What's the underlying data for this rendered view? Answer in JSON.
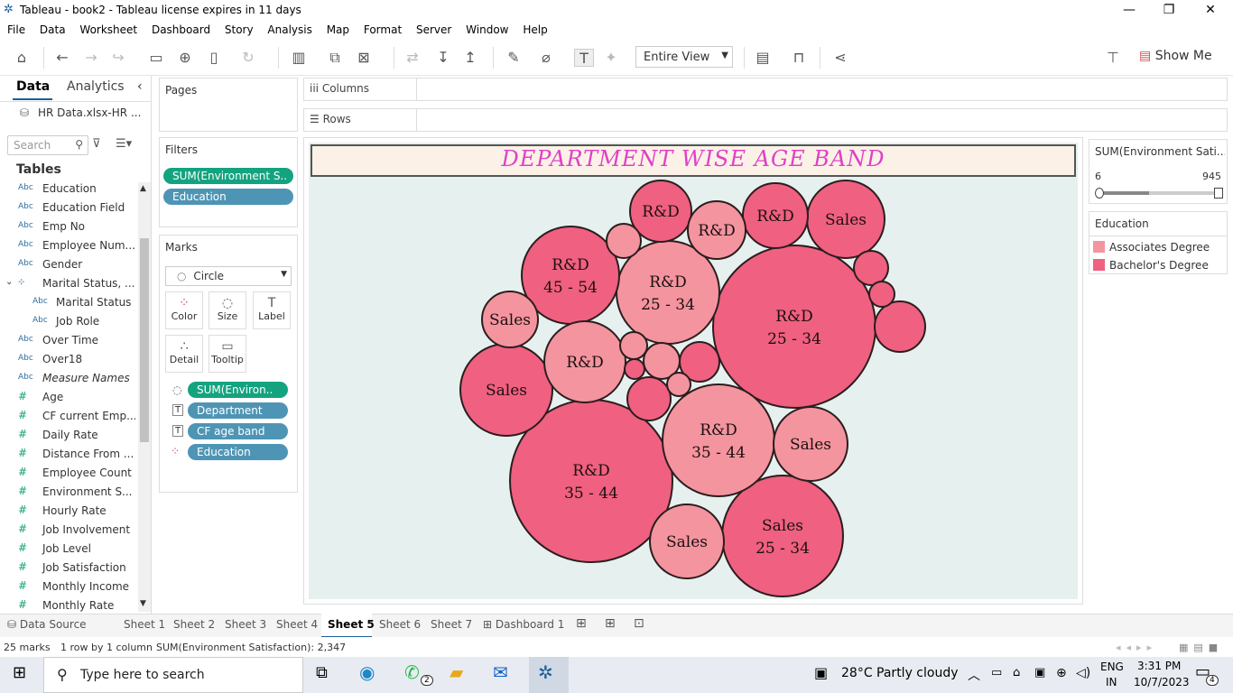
{
  "window": {
    "title": "Tableau - book2 - Tableau license expires in 11 days",
    "min": "—",
    "restore": "❐",
    "close": "✕"
  },
  "menu": [
    "File",
    "Data",
    "Worksheet",
    "Dashboard",
    "Story",
    "Analysis",
    "Map",
    "Format",
    "Server",
    "Window",
    "Help"
  ],
  "toolbar": {
    "view_select": "Entire View",
    "show_me": "Show Me"
  },
  "data_pane": {
    "tab_data": "Data",
    "tab_analytics": "Analytics",
    "datasource": "HR Data.xlsx-HR ...",
    "search_placeholder": "Search",
    "tables_header": "Tables",
    "fields": [
      {
        "type": "Abc",
        "name": "Education",
        "sub": false
      },
      {
        "type": "Abc",
        "name": "Education Field",
        "sub": false
      },
      {
        "type": "Abc",
        "name": "Emp No",
        "sub": false
      },
      {
        "type": "Abc",
        "name": "Employee Num...",
        "sub": false
      },
      {
        "type": "Abc",
        "name": "Gender",
        "sub": false
      },
      {
        "type": "hier",
        "name": "Marital Status, ...",
        "sub": false
      },
      {
        "type": "Abc",
        "name": "Marital Status",
        "sub": true
      },
      {
        "type": "Abc",
        "name": "Job Role",
        "sub": true
      },
      {
        "type": "Abc",
        "name": "Over Time",
        "sub": false
      },
      {
        "type": "Abc",
        "name": "Over18",
        "sub": false
      },
      {
        "type": "Abc",
        "name": "Measure Names",
        "sub": false
      },
      {
        "type": "#",
        "name": "Age",
        "sub": false
      },
      {
        "type": "#",
        "name": "CF current Emp...",
        "sub": false
      },
      {
        "type": "#",
        "name": "Daily Rate",
        "sub": false
      },
      {
        "type": "#",
        "name": "Distance From ...",
        "sub": false
      },
      {
        "type": "#",
        "name": "Employee Count",
        "sub": false
      },
      {
        "type": "#",
        "name": "Environment S...",
        "sub": false
      },
      {
        "type": "#",
        "name": "Hourly Rate",
        "sub": false
      },
      {
        "type": "#",
        "name": "Job Involvement",
        "sub": false
      },
      {
        "type": "#",
        "name": "Job Level",
        "sub": false
      },
      {
        "type": "#",
        "name": "Job Satisfaction",
        "sub": false
      },
      {
        "type": "#",
        "name": "Monthly Income",
        "sub": false
      },
      {
        "type": "#",
        "name": "Monthly Rate",
        "sub": false
      }
    ]
  },
  "pages": {
    "title": "Pages"
  },
  "filters": {
    "title": "Filters",
    "pills": [
      "SUM(Environment S..",
      "Education"
    ]
  },
  "marks": {
    "title": "Marks",
    "type": "Circle",
    "buttons": [
      "Color",
      "Size",
      "Label",
      "Detail",
      "Tooltip"
    ],
    "fields": [
      "SUM(Environ..",
      "Department",
      "CF age band",
      "Education"
    ]
  },
  "shelves": {
    "columns": "Columns",
    "rows": "Rows"
  },
  "viz": {
    "title": "DEPARTMENT WISE AGE BAND"
  },
  "legend_range": {
    "title": "SUM(Environment Sati...",
    "min": "6",
    "max": "945"
  },
  "legend_color": {
    "title": "Education",
    "items": [
      {
        "label": "Associates Degree",
        "color": "#f4949f"
      },
      {
        "label": "Bachelor's Degree",
        "color": "#f06080"
      }
    ]
  },
  "sheet_tabs": [
    "Data Source",
    "Sheet 1",
    "Sheet 2",
    "Sheet 3",
    "Sheet 4",
    "Sheet 5",
    "Sheet 6",
    "Sheet 7",
    "Dashboard 1"
  ],
  "active_sheet": "Sheet 5",
  "status": {
    "marks": "25 marks",
    "layout": "1 row by 1 column",
    "sum": "SUM(Environment Satisfaction): 2,347"
  },
  "taskbar": {
    "search": "Type here to search",
    "weather": "28°C  Partly cloudy",
    "lang1": "ENG",
    "lang2": "IN",
    "time": "3:31 PM",
    "date": "10/7/2023",
    "notif": "4",
    "whatsapp_badge": "2"
  },
  "chart_data": {
    "type": "packed-bubble",
    "title": "DEPARTMENT WISE AGE BAND",
    "colors": {
      "Associates Degree": "#f4949f",
      "Bachelor's Degree": "#f06080"
    },
    "bubbles": [
      {
        "department": "R&D",
        "age_band": "25 - 34",
        "education": "Bachelor's Degree"
      },
      {
        "department": "R&D",
        "age_band": "35 - 44",
        "education": "Bachelor's Degree"
      },
      {
        "department": "Sales",
        "age_band": "25 - 34",
        "education": "Bachelor's Degree"
      },
      {
        "department": "R&D",
        "age_band": "35 - 44",
        "education": "Associates Degree"
      },
      {
        "department": "R&D",
        "age_band": "25 - 34",
        "education": "Associates Degree"
      },
      {
        "department": "R&D",
        "age_band": "45 - 54",
        "education": "Bachelor's Degree"
      },
      {
        "department": "Sales",
        "age_band": "",
        "education": "Bachelor's Degree"
      },
      {
        "department": "R&D",
        "age_band": "",
        "education": "Associates Degree"
      },
      {
        "department": "Sales",
        "age_band": "",
        "education": "Associates Degree"
      },
      {
        "department": "Sales",
        "age_band": "",
        "education": "Associates Degree"
      },
      {
        "department": "Sales",
        "age_band": "",
        "education": "Bachelor's Degree"
      },
      {
        "department": "Sales",
        "age_band": "",
        "education": "Associates Degree"
      },
      {
        "department": "R&D",
        "age_band": "",
        "education": "Bachelor's Degree"
      },
      {
        "department": "R&D",
        "age_band": "",
        "education": "Bachelor's Degree"
      },
      {
        "department": "R&D",
        "age_band": "",
        "education": "Associates Degree"
      },
      {
        "department": "",
        "age_band": "",
        "education": "Bachelor's Degree"
      },
      {
        "department": "",
        "age_band": "",
        "education": "Bachelor's Degree"
      },
      {
        "department": "",
        "age_band": "",
        "education": "Associates Degree"
      },
      {
        "department": "",
        "age_band": "",
        "education": "Bachelor's Degree"
      },
      {
        "department": "",
        "age_band": "",
        "education": "Bachelor's Degree"
      },
      {
        "department": "",
        "age_band": "",
        "education": "Associates Degree"
      },
      {
        "department": "",
        "age_band": "",
        "education": "Bachelor's Degree"
      },
      {
        "department": "",
        "age_band": "",
        "education": "Associates Degree"
      },
      {
        "department": "",
        "age_band": "",
        "education": "Bachelor's Degree"
      },
      {
        "department": "",
        "age_band": "",
        "education": "Associates Degree"
      }
    ]
  }
}
